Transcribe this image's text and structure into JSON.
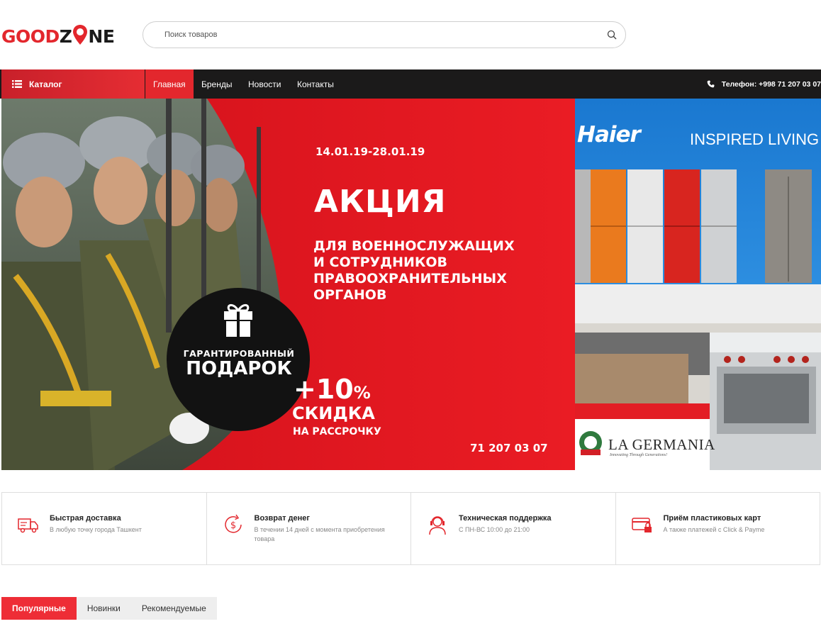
{
  "logo": {
    "part1": "GOOD",
    "part2": "Z",
    "part3": "NE",
    "alt": "GOODZONE"
  },
  "search": {
    "placeholder": "Поиск товаров"
  },
  "nav": {
    "catalog_label": "Каталог",
    "items": [
      "Главная",
      "Бренды",
      "Новости",
      "Контакты"
    ],
    "active_index": 0,
    "phone": "Телефон: +998 71 207 03 07"
  },
  "banner_main": {
    "date": "14.01.19-28.01.19",
    "title": "АКЦИЯ",
    "subtitle_lines": [
      "ДЛЯ ВОЕННОСЛУЖАЩИХ",
      "И СОТРУДНИКОВ",
      "ПРАВООХРАНИТЕЛЬНЫХ",
      "ОРГАНОВ"
    ],
    "gift_caption": "ГАРАНТИРОВАННЫЙ",
    "gift_title": "ПОДАРОК",
    "discount_value": "+10",
    "discount_unit": "%",
    "discount_label": "СКИДКА",
    "installment": "НА РАССРОЧКУ",
    "phone": "71 207 03 07"
  },
  "banner_side": {
    "brand": "Haier",
    "slogan": "INSPIRED LIVING",
    "brand2": "LA GERMANIA",
    "brand2_tagline": "Innovating Through Generations!"
  },
  "features": [
    {
      "icon": "delivery-truck-icon",
      "title": "Быстрая доставка",
      "text": "В любую точку города Ташкент"
    },
    {
      "icon": "money-back-icon",
      "title": "Возврат денег",
      "text": "В течении 14 дней с момента приобретения товара"
    },
    {
      "icon": "support-headset-icon",
      "title": "Техническая поддержка",
      "text": "С ПН-ВС 10:00 до 21:00"
    },
    {
      "icon": "credit-card-icon",
      "title": "Приём пластиковых карт",
      "text": "А также платежей с Click & Payme"
    }
  ],
  "tabs": {
    "items": [
      "Популярные",
      "Новинки",
      "Рекомендуемые"
    ],
    "active_index": 0
  },
  "colors": {
    "brand_red": "#e3272d",
    "navbar": "#1b1a1a",
    "tab_active": "#ee2d36",
    "haier_blue": "#1f7fd4"
  }
}
